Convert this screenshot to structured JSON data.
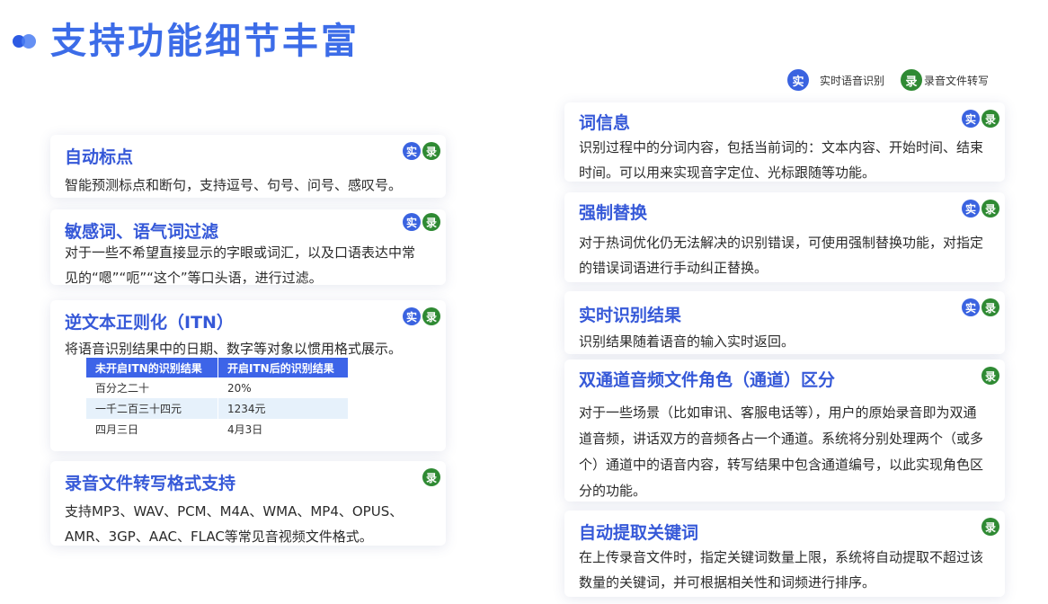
{
  "page": {
    "title": "支持功能细节丰富"
  },
  "legend": {
    "realtime": {
      "badge": "实",
      "label": "实时语音识别"
    },
    "recording": {
      "badge": "录",
      "label": "录音文件转写"
    }
  },
  "badges": {
    "realtime": "实",
    "recording": "录"
  },
  "colors": {
    "title": "#3c6ce8",
    "heading": "#3659d8",
    "realtime_badge": "#3a63e0",
    "recording_badge": "#2f8a33",
    "table_header": "#3d64e8",
    "table_alt_row": "#e6f1fb"
  },
  "left_cards": [
    {
      "title": "自动标点",
      "text": "智能预测标点和断句，支持逗号、句号、问号、感叹号。"
    },
    {
      "title": "敏感词、语气词过滤",
      "text": "对于一些不希望直接显示的字眼或词汇，以及口语表达中常见的“嗯”“呃”“这个”等口头语，进行过滤。"
    },
    {
      "title": "逆文本正则化（ITN）",
      "text": "将语音识别结果中的日期、数字等对象以惯用格式展示。"
    },
    {
      "title": "录音文件转写格式支持",
      "text": "支持MP3、WAV、PCM、M4A、WMA、MP4、OPUS、AMR、3GP、AAC、FLAC等常见音视频文件格式。"
    }
  ],
  "itn_table": {
    "headers": [
      "未开启ITN的识别结果",
      "开启ITN后的识别结果"
    ],
    "rows": [
      [
        "百分之二十",
        "20%"
      ],
      [
        "一千二百三十四元",
        "1234元"
      ],
      [
        "四月三日",
        "4月3日"
      ]
    ]
  },
  "right_cards": [
    {
      "title": "词信息",
      "text": "识别过程中的分词内容，包括当前词的：文本内容、开始时间、结束时间。可以用来实现音字定位、光标跟随等功能。"
    },
    {
      "title": "强制替换",
      "text": "对于热词优化仍无法解决的识别错误，可使用强制替换功能，对指定的错误词语进行手动纠正替换。"
    },
    {
      "title": "实时识别结果",
      "text": "识别结果随着语音的输入实时返回。"
    },
    {
      "title": "双通道音频文件角色（通道）区分",
      "text": "对于一些场景（比如审讯、客服电话等），用户的原始录音即为双通道音频，讲话双方的音频各占一个通道。系统将分别处理两个（或多个）通道中的语音内容，转写结果中包含通道编号，以此实现角色区分的功能。"
    },
    {
      "title": "自动提取关键词",
      "text": "在上传录音文件时，指定关键词数量上限，系统将自动提取不超过该数量的关键词，并可根据相关性和词频进行排序。"
    }
  ]
}
